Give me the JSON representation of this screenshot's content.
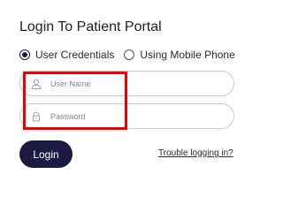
{
  "header": {
    "title": "Login To Patient Portal"
  },
  "login_method": {
    "options": [
      {
        "label": "User Credentials",
        "selected": true
      },
      {
        "label": "Using Mobile Phone",
        "selected": false
      }
    ]
  },
  "form": {
    "username_placeholder": "User Name",
    "password_placeholder": "Password"
  },
  "actions": {
    "login_label": "Login",
    "trouble_link": "Trouble logging in?"
  },
  "colors": {
    "primary": "#1c1943",
    "highlight": "#ee0000"
  },
  "icons": {
    "username": "user-icon",
    "password": "lock-icon"
  }
}
